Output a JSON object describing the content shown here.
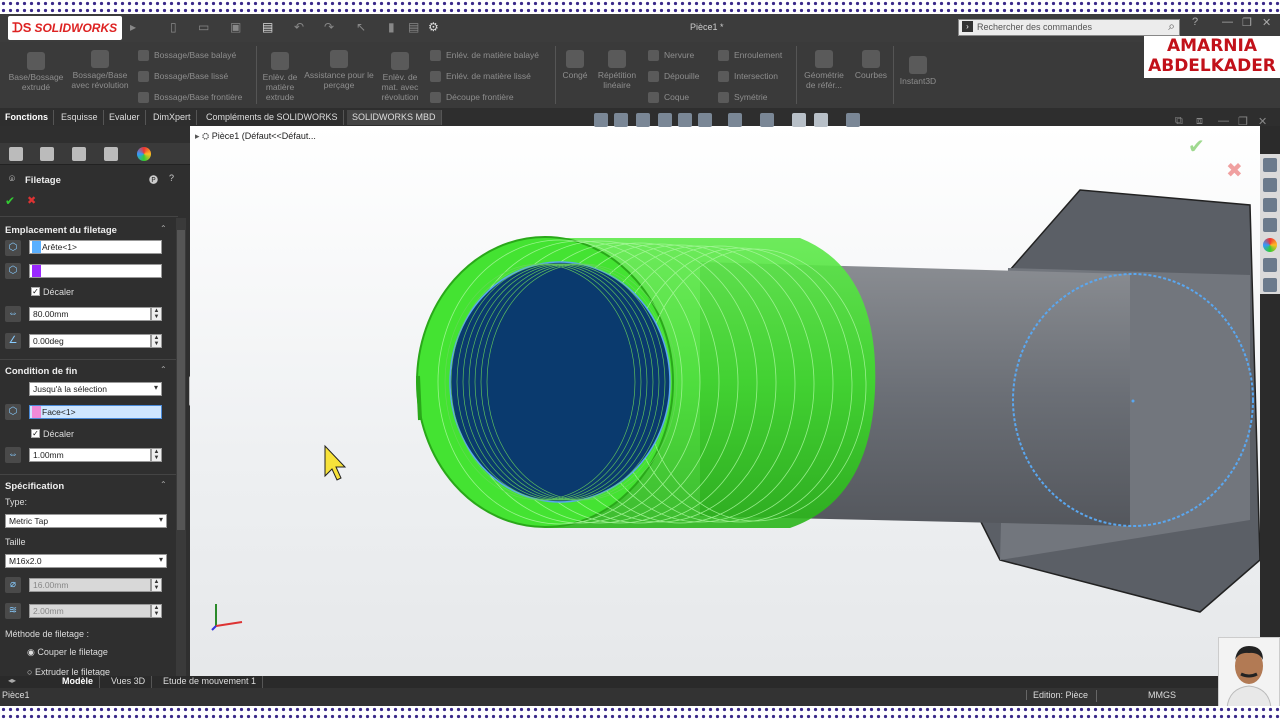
{
  "app": {
    "name": "SOLIDWORKS",
    "document_title": "Pièce1 *"
  },
  "search": {
    "placeholder": "Rechercher des commandes"
  },
  "brand_overlay": {
    "line1": "AMARNIA",
    "line2": "ABDELKADER"
  },
  "ribbon": {
    "big": [
      {
        "label": "Base/Bossage extrudé"
      },
      {
        "label": "Bossage/Base avec révolution"
      },
      {
        "label": "Enlèv. de matière extrude"
      },
      {
        "label": "Assistance pour le perçage"
      },
      {
        "label": "Enlèv. de mat. avec révolution"
      },
      {
        "label": "Congé"
      },
      {
        "label": "Répétition linéaire"
      },
      {
        "label": "Géométrie de référ..."
      },
      {
        "label": "Courbes"
      },
      {
        "label": "Instant3D"
      }
    ],
    "small": [
      {
        "label": "Bossage/Base balayé"
      },
      {
        "label": "Bossage/Base lissé"
      },
      {
        "label": "Bossage/Base frontière"
      },
      {
        "label": "Enlév. de matière balayé"
      },
      {
        "label": "Enlév. de matière lissé"
      },
      {
        "label": "Découpe frontière"
      },
      {
        "label": "Nervure"
      },
      {
        "label": "Dépouille"
      },
      {
        "label": "Coque"
      },
      {
        "label": "Enroulement"
      },
      {
        "label": "Intersection"
      },
      {
        "label": "Symétrie"
      }
    ]
  },
  "command_tabs": [
    "Fonctions",
    "Esquisse",
    "Evaluer",
    "DimXpert",
    "Compléments de SOLIDWORKS",
    "SOLIDWORKS MBD"
  ],
  "feature_tree": {
    "root": "Pièce1  (Défaut<<Défaut..."
  },
  "property_manager": {
    "title": "Filetage",
    "section_location": "Emplacement du filetage",
    "edge_value": "Arête<1>",
    "offset_check_label": "Décaler",
    "offset_distance": "80.00mm",
    "angle": "0.00deg",
    "section_end": "Condition de fin",
    "end_condition": "Jusqu'à la sélection",
    "face_value": "Face<1>",
    "end_offset_check_label": "Décaler",
    "end_offset": "1.00mm",
    "section_spec": "Spécification",
    "type_label": "Type:",
    "type_value": "Metric Tap",
    "size_label": "Taille",
    "size_value": "M16x2.0",
    "diameter": "16.00mm",
    "pitch": "2.00mm",
    "method_label": "Méthode de filetage :",
    "method_cut": "Couper le filetage",
    "method_extrude": "Extruder le filetage"
  },
  "bottom_tabs": [
    "Modèle",
    "Vues 3D",
    "Etude de mouvement 1"
  ],
  "status": {
    "left": "Pièce1",
    "edition": "Edition: Pièce",
    "units": "MMGS"
  },
  "colors": {
    "thread_green": "#3ddc2a",
    "bore_blue": "#0a3a6e",
    "edge_blue": "#5aa7f0",
    "shaft_gray": "#6c7077"
  }
}
